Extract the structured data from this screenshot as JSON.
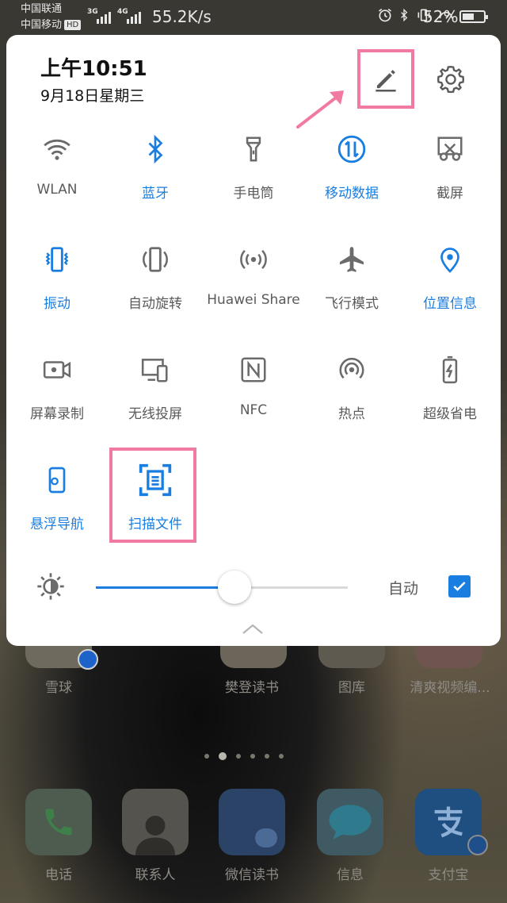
{
  "status_bar": {
    "carrier1": "中国联通",
    "carrier2": "中国移动",
    "hd_badge": "HD",
    "net1": "3G",
    "net2": "4G",
    "speed": "55.2K/s",
    "battery": "52%",
    "icons": [
      "alarm-icon",
      "bluetooth-icon",
      "vibrate-icon",
      "speed-gauge-icon"
    ]
  },
  "panel": {
    "time": "上午10:51",
    "date": "9月18日星期三",
    "edit_icon": "pencil-icon",
    "settings_icon": "gear-icon",
    "accent_color": "#1a7ee0",
    "highlight_color": "#f07aa0"
  },
  "tiles": [
    {
      "label": "WLAN",
      "icon": "wifi-icon",
      "active": false
    },
    {
      "label": "蓝牙",
      "icon": "bluetooth-icon",
      "active": true
    },
    {
      "label": "手电筒",
      "icon": "flashlight-icon",
      "active": false
    },
    {
      "label": "移动数据",
      "icon": "mobile-data-icon",
      "active": true
    },
    {
      "label": "截屏",
      "icon": "screenshot-icon",
      "active": false
    },
    {
      "label": "振动",
      "icon": "vibrate-icon",
      "active": true
    },
    {
      "label": "自动旋转",
      "icon": "auto-rotate-icon",
      "active": false
    },
    {
      "label": "Huawei Share",
      "icon": "huawei-share-icon",
      "active": false
    },
    {
      "label": "飞行模式",
      "icon": "airplane-icon",
      "active": false
    },
    {
      "label": "位置信息",
      "icon": "location-icon",
      "active": true
    },
    {
      "label": "屏幕录制",
      "icon": "screen-record-icon",
      "active": false
    },
    {
      "label": "无线投屏",
      "icon": "wireless-projection-icon",
      "active": false
    },
    {
      "label": "NFC",
      "icon": "nfc-icon",
      "active": false
    },
    {
      "label": "热点",
      "icon": "hotspot-icon",
      "active": false
    },
    {
      "label": "超级省电",
      "icon": "power-saving-icon",
      "active": false
    },
    {
      "label": "悬浮导航",
      "icon": "floating-nav-icon",
      "active": true
    },
    {
      "label": "扫描文件",
      "icon": "scan-document-icon",
      "active": true
    }
  ],
  "brightness": {
    "level": 0.55,
    "auto_label": "自动",
    "auto_checked": true
  },
  "home_screen": {
    "row1": [
      "雪球",
      "樊登读书",
      "图库",
      "清爽视频编..."
    ],
    "dock": [
      "电话",
      "联系人",
      "微信读书",
      "信息",
      "支付宝"
    ],
    "pages": 6,
    "current_page": 2
  }
}
